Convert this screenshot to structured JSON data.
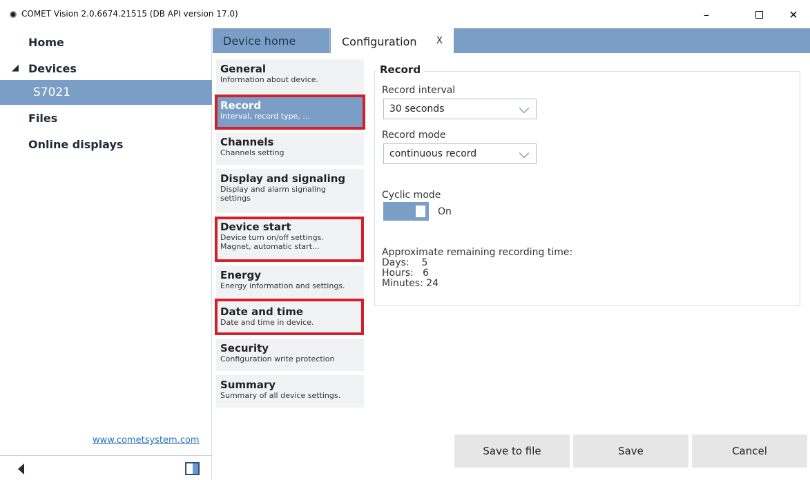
{
  "window": {
    "title": "COMET Vision 2.0.6674.21515 (DB API version 17.0)",
    "minimize_glyph": "–",
    "close_glyph": "✕"
  },
  "sidebar": {
    "home": "Home",
    "devices": "Devices",
    "devices_expander": "◢",
    "device": "S7021",
    "files": "Files",
    "online_displays": "Online displays",
    "website": "www.cometsystem.com"
  },
  "tabs": {
    "device_home": "Device home",
    "configuration": "Configuration",
    "close": "X"
  },
  "menu": [
    {
      "title": "General",
      "desc": "Information about device."
    },
    {
      "title": "Record",
      "desc": "Interval, record type, ..."
    },
    {
      "title": "Channels",
      "desc": "Channels setting"
    },
    {
      "title": "Display and signaling",
      "desc": "Display and alarm signaling settings"
    },
    {
      "title": "Device start",
      "desc": "Device turn on/off settings. Magnet, automatic start..."
    },
    {
      "title": "Energy",
      "desc": "Energy information and settings."
    },
    {
      "title": "Date and time",
      "desc": "Date and time in device."
    },
    {
      "title": "Security",
      "desc": "Configuration write protection"
    },
    {
      "title": "Summary",
      "desc": "Summary of all device settings."
    }
  ],
  "record": {
    "section_title": "Record",
    "interval_label": "Record interval",
    "interval_value": "30 seconds",
    "mode_label": "Record mode",
    "mode_value": "continuous record",
    "cyclic_label": "Cyclic mode",
    "cyclic_state": "On",
    "cyclic_on": true,
    "remaining_label": "Approximate remaining recording time:",
    "days_label": "Days:",
    "days_value": "5",
    "hours_label": "Hours:",
    "hours_value": "6",
    "minutes_label": "Minutes:",
    "minutes_value": "24"
  },
  "buttons": {
    "save_to_file": "Save to file",
    "save": "Save",
    "cancel": "Cancel"
  },
  "colors": {
    "accent": "#7b9ec7",
    "highlight": "#d21f2a",
    "link": "#2b72b8"
  }
}
